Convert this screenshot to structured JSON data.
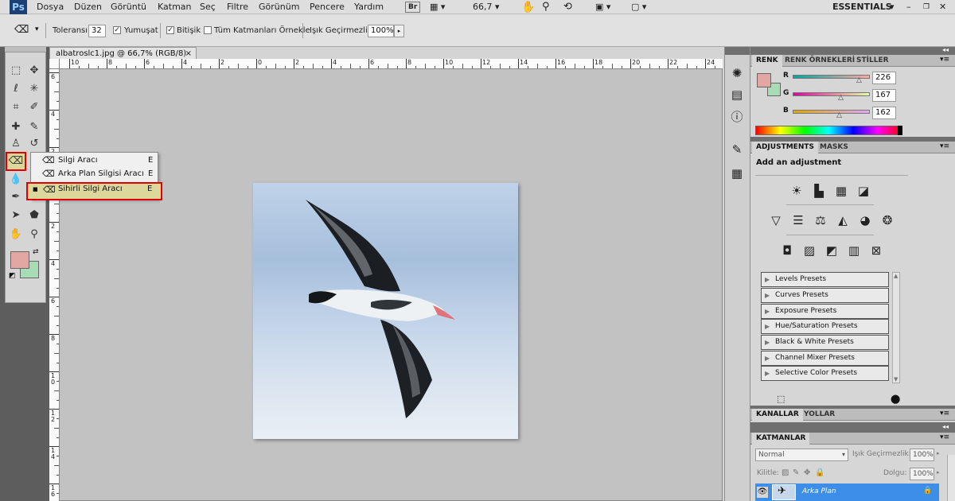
{
  "app": {
    "logo": "Ps"
  },
  "menubar": {
    "items": [
      "Dosya",
      "Düzen",
      "Görüntü",
      "Katman",
      "Seç",
      "Filtre",
      "Görünüm",
      "Pencere",
      "Yardım"
    ],
    "br_label": "Br",
    "zoom": "66,7",
    "workspace": "ESSENTIALS"
  },
  "options": {
    "tolerance_label": "Toleransı:",
    "tolerance_value": "32",
    "antialias_label": "Yumuşat",
    "contiguous_label": "Bitişik",
    "sample_all_label": "Tüm Katmanları Örnekle",
    "opacity_label": "Işık Geçirmezlik:",
    "opacity_value": "100%"
  },
  "document": {
    "tab_title": "albatroslc1.jpg @ 66,7% (RGB/8)",
    "close_glyph": "×",
    "hruler_labels": [
      "10",
      "8",
      "6",
      "4",
      "2",
      "0",
      "2",
      "4",
      "6",
      "8",
      "10",
      "12",
      "14",
      "16",
      "18",
      "20",
      "22",
      "24"
    ],
    "vruler_labels": [
      "6",
      "4",
      "2",
      "0",
      "2",
      "4",
      "6",
      "8",
      "10",
      "12",
      "14",
      "16"
    ]
  },
  "flyout": {
    "items": [
      {
        "label": "Silgi Aracı",
        "key": "E"
      },
      {
        "label": "Arka Plan Silgisi Aracı",
        "key": "E"
      },
      {
        "label": "Sihirli Silgi Aracı",
        "key": "E"
      }
    ]
  },
  "color_panel": {
    "tabs": [
      "RENK",
      "RENK ÖRNEKLERİ",
      "STİLLER"
    ],
    "channels": [
      {
        "name": "R",
        "value": "226",
        "fraction": 0.886
      },
      {
        "name": "G",
        "value": "167",
        "fraction": 0.655
      },
      {
        "name": "B",
        "value": "162",
        "fraction": 0.635
      }
    ],
    "foreground": "#e2a7a2",
    "background": "#a9dcb6"
  },
  "adjustments_panel": {
    "tabs": [
      "ADJUSTMENTS",
      "MASKS"
    ],
    "heading": "Add an adjustment",
    "presets": [
      "Levels Presets",
      "Curves Presets",
      "Exposure Presets",
      "Hue/Saturation Presets",
      "Black & White Presets",
      "Channel Mixer Presets",
      "Selective Color Presets"
    ]
  },
  "channels_panel": {
    "tabs": [
      "KANALLAR",
      "YOLLAR"
    ]
  },
  "layers_panel": {
    "tab": "KATMANLAR",
    "blend_mode": "Normal",
    "opacity_label": "Işık Geçirmezlik:",
    "opacity_value": "100%",
    "lock_label": "Kilitle:",
    "fill_label": "Dolgu:",
    "fill_value": "100%",
    "layer_name": "Arka Plan"
  },
  "colors": {
    "accent_red": "#e00000",
    "selected_layer": "#3d8ee6",
    "tool_highlight": "#dcd79a"
  }
}
